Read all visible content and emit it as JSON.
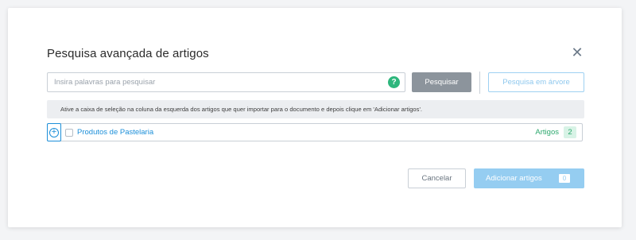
{
  "dialog": {
    "title": "Pesquisa avançada de artigos",
    "close_icon": "close-icon"
  },
  "search": {
    "placeholder": "Insira palavras para pesquisar",
    "value": "",
    "help_glyph": "?",
    "search_label": "Pesquisar",
    "tree_search_label": "Pesquisa em árvore"
  },
  "info": {
    "text": "Ative a caixa de seleção na coluna da esquerda dos artigos que quer importar para o documento e depois clique em 'Adicionar artigos'."
  },
  "tree": {
    "rows": [
      {
        "label": "Produtos de Pastelaria",
        "count_label": "Artigos",
        "count": "2",
        "checked": false,
        "expand_icon": "plus-circle-icon"
      }
    ]
  },
  "footer": {
    "cancel_label": "Cancelar",
    "add_label": "Adicionar artigos",
    "add_count": "0"
  },
  "colors": {
    "accent": "#1c8fd9",
    "success": "#2da86e",
    "search_button": "#8c949c",
    "add_button_disabled": "#95cdf1"
  }
}
